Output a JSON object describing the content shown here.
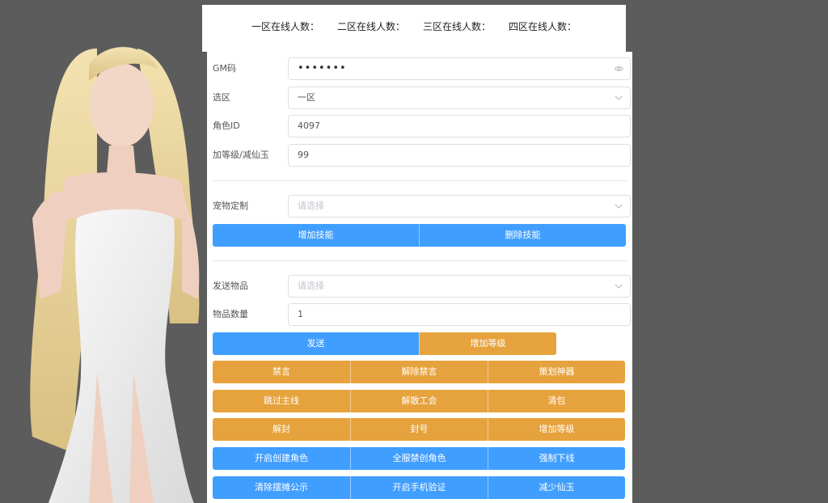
{
  "servers": [
    {
      "label": "一区在线人数："
    },
    {
      "label": "二区在线人数："
    },
    {
      "label": "三区在线人数："
    },
    {
      "label": "四区在线人数："
    }
  ],
  "form": {
    "gm_code": {
      "label": "GM码",
      "value": "•••••••",
      "icon": "eye-icon"
    },
    "zone": {
      "label": "选区",
      "value": "一区",
      "icon": "chevron-down-icon"
    },
    "role_id": {
      "label": "角色ID",
      "value": "4097"
    },
    "level_jade": {
      "label": "加等级/减仙玉",
      "value": "99"
    },
    "pet": {
      "label": "宠物定制",
      "placeholder": "请选择",
      "icon": "chevron-down-icon"
    },
    "item": {
      "label": "发送物品",
      "placeholder": "请选择",
      "icon": "chevron-down-icon"
    },
    "item_qty": {
      "label": "物品数量",
      "value": "1"
    }
  },
  "buttons": {
    "add_skill": "增加技能",
    "delete_skill": "删除技能",
    "send": "发送",
    "add_level_1": "增加等级",
    "mute": "禁言",
    "unmute": "解除禁言",
    "planner_artifact": "策划神器",
    "skip_main": "跳过主线",
    "disband_guild": "解散工会",
    "clear_bag": "清包",
    "unban": "解封",
    "ban": "封号",
    "add_level_2": "增加等级",
    "enable_create_role": "开启创建角色",
    "ban_create_role_all": "全服禁创角色",
    "force_offline": "强制下线",
    "clear_stall_notice": "清除摆摊公示",
    "enable_phone_verify": "开启手机验证",
    "reduce_jade": "减少仙玉"
  },
  "colors": {
    "primary": "#409eff",
    "warning": "#e6a23c",
    "background": "#5c5c5c"
  }
}
